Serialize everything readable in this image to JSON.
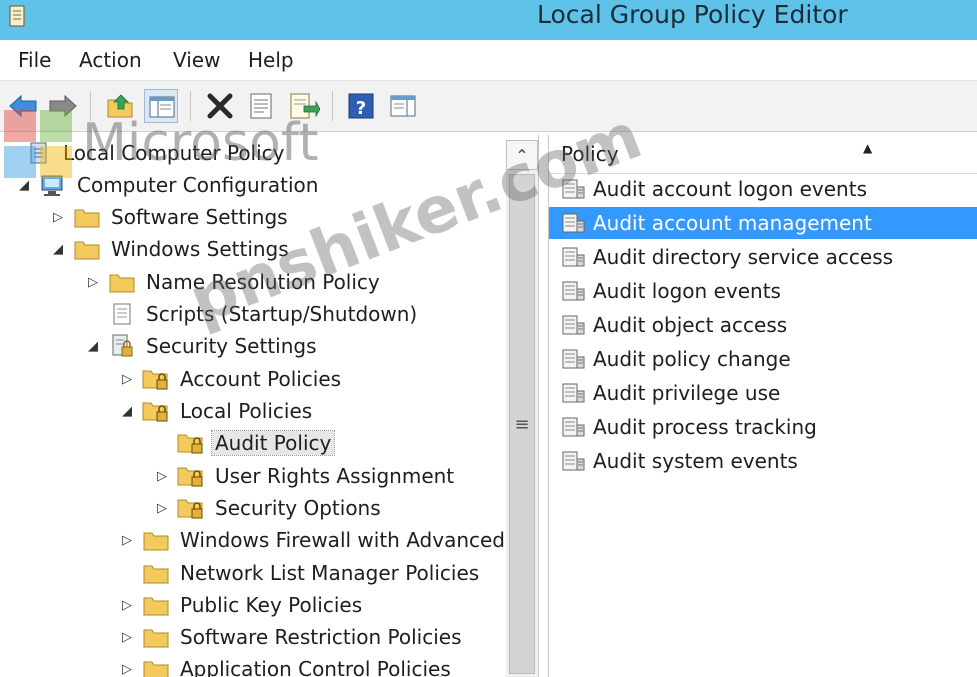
{
  "window": {
    "title": "Local Group Policy Editor"
  },
  "menu": {
    "items": [
      "File",
      "Action",
      "View",
      "Help"
    ]
  },
  "toolbar": {
    "buttons": [
      "back-icon",
      "forward-icon",
      "up-folder-icon",
      "show-hide-tree-icon",
      "delete-icon",
      "properties-icon",
      "export-list-icon",
      "help-icon",
      "show-pane-icon"
    ]
  },
  "tree": {
    "items": [
      {
        "label": "Local Computer Policy",
        "icon": "policy-icon",
        "expander": ""
      },
      {
        "label": "Computer Configuration",
        "icon": "computer-icon",
        "expander": "◢"
      },
      {
        "label": "Software Settings",
        "icon": "folder-icon",
        "expander": "▷"
      },
      {
        "label": "Windows Settings",
        "icon": "folder-icon",
        "expander": "◢"
      },
      {
        "label": "Name Resolution Policy",
        "icon": "folder-icon",
        "expander": "▷"
      },
      {
        "label": "Scripts (Startup/Shutdown)",
        "icon": "script-icon",
        "expander": ""
      },
      {
        "label": "Security Settings",
        "icon": "security-icon",
        "expander": "◢"
      },
      {
        "label": "Account Policies",
        "icon": "locked-folder-icon",
        "expander": "▷"
      },
      {
        "label": "Local Policies",
        "icon": "locked-folder-icon",
        "expander": "◢"
      },
      {
        "label": "Audit Policy",
        "icon": "locked-folder-icon",
        "expander": ""
      },
      {
        "label": "User Rights Assignment",
        "icon": "locked-folder-icon",
        "expander": "▷"
      },
      {
        "label": "Security Options",
        "icon": "locked-folder-icon",
        "expander": "▷"
      },
      {
        "label": "Windows Firewall with Advanced",
        "icon": "folder-icon",
        "expander": "▷"
      },
      {
        "label": "Network List Manager Policies",
        "icon": "folder-icon",
        "expander": ""
      },
      {
        "label": "Public Key Policies",
        "icon": "folder-icon",
        "expander": "▷"
      },
      {
        "label": "Software Restriction Policies",
        "icon": "folder-icon",
        "expander": "▷"
      },
      {
        "label": "Application Control Policies",
        "icon": "folder-icon",
        "expander": "▷"
      }
    ],
    "selected_label": "Audit Policy"
  },
  "scrollbar": {
    "up_arrow": "⌃",
    "grip": "≡"
  },
  "list": {
    "column_header": "Policy",
    "sort_indicator": "▲",
    "rows": [
      "Audit account logon events",
      "Audit account management",
      "Audit directory service access",
      "Audit logon events",
      "Audit object access",
      "Audit policy change",
      "Audit privilege use",
      "Audit process tracking",
      "Audit system events"
    ],
    "selected_row": "Audit account management"
  },
  "watermarks": {
    "brand": "Microsoft",
    "site": "pnshiker.com"
  },
  "colors": {
    "titlebar": "#5fc2e8",
    "selection": "#3399ff",
    "folder": "#f2cb5c"
  }
}
